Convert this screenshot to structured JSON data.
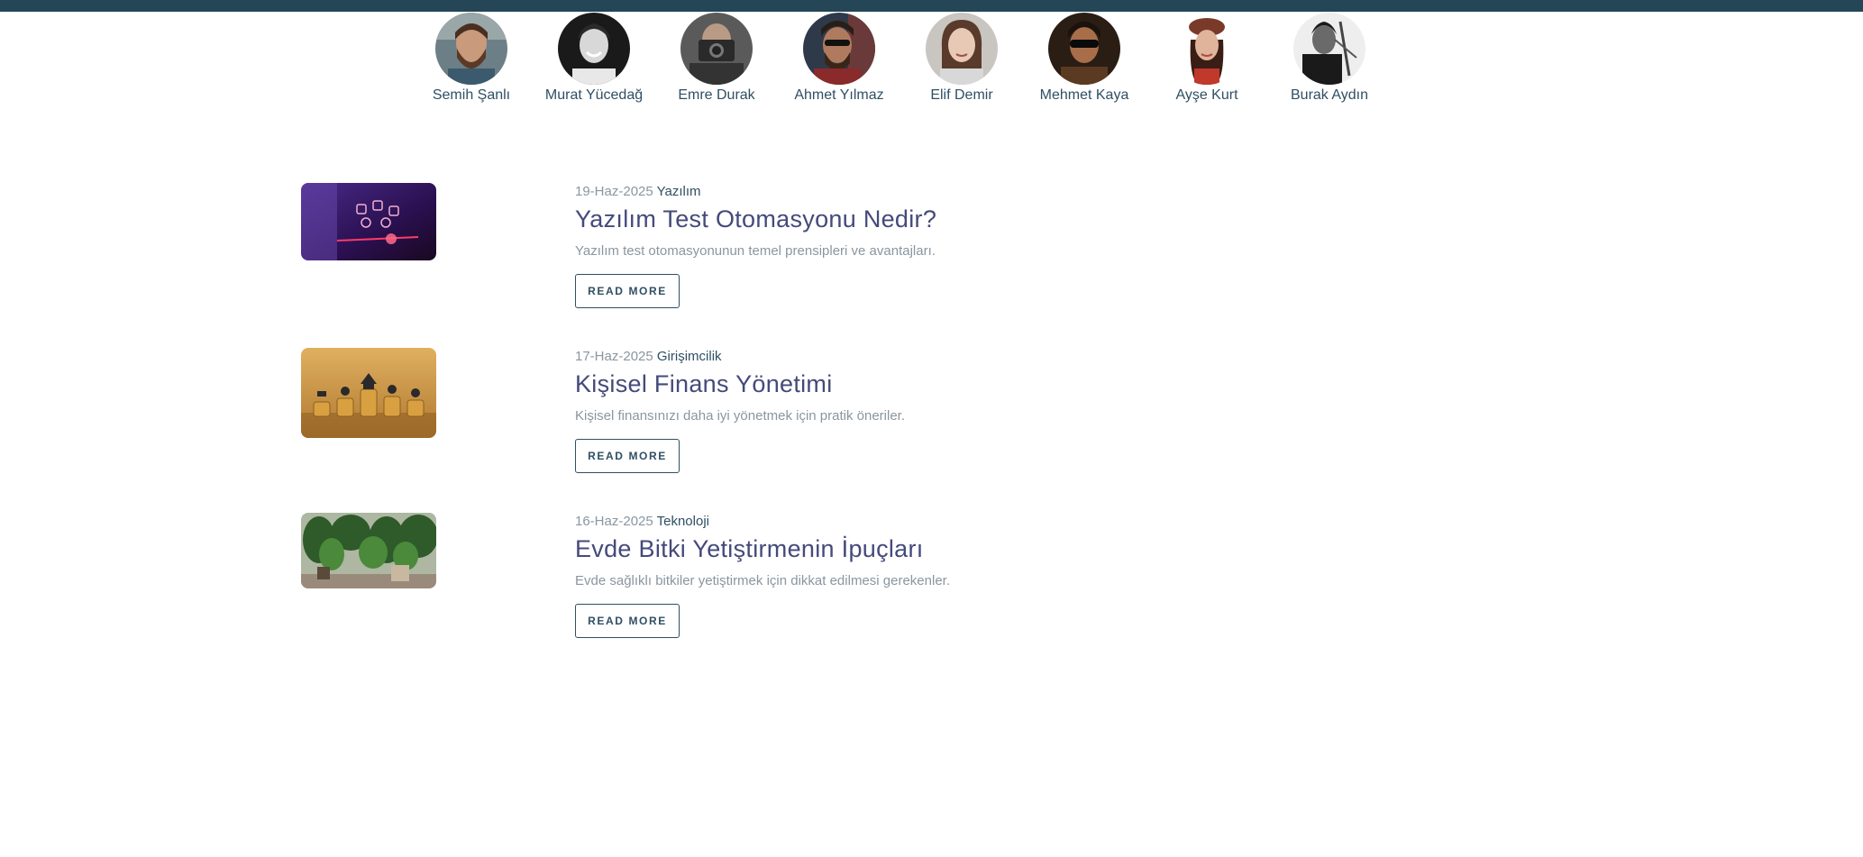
{
  "authors": [
    {
      "name": "Semih Şanlı",
      "avatar": "bearded-man-photo"
    },
    {
      "name": "Murat Yücedağ",
      "avatar": "smiling-man-photo"
    },
    {
      "name": "Emre Durak",
      "avatar": "man-with-camera-photo"
    },
    {
      "name": "Ahmet Yılmaz",
      "avatar": "man-with-sunglasses-photo"
    },
    {
      "name": "Elif Demir",
      "avatar": "woman-smiling-photo"
    },
    {
      "name": "Mehmet Kaya",
      "avatar": "man-in-sunglasses-photo"
    },
    {
      "name": "Ayşe Kurt",
      "avatar": "woman-with-beret-photo"
    },
    {
      "name": "Burak Aydın",
      "avatar": "man-playing-violin-photo"
    }
  ],
  "posts": [
    {
      "date": "19-Haz-2025",
      "category": "Yazılım",
      "title": "Yazılım Test Otomasyonu Nedir?",
      "excerpt": "Yazılım test otomasyonunun temel prensipleri ve avantajları.",
      "button": "Read More",
      "image": "tech-icons-purple-image"
    },
    {
      "date": "17-Haz-2025",
      "category": "Girişimcilik",
      "title": "Kişisel Finans Yönetimi",
      "excerpt": "Kişisel finansınızı daha iyi yönetmek için pratik öneriler.",
      "button": "Read More",
      "image": "coin-stacks-image"
    },
    {
      "date": "16-Haz-2025",
      "category": "Teknoloji",
      "title": "Evde Bitki Yetiştirmenin İpuçları",
      "excerpt": "Evde sağlıklı bitkiler yetiştirmek için dikkat edilmesi gerekenler.",
      "button": "Read More",
      "image": "indoor-plants-image"
    }
  ],
  "colors": {
    "topbar": "#244657",
    "title": "#444a7a",
    "accent": "#2f4f63",
    "muted": "#8a96a0"
  }
}
